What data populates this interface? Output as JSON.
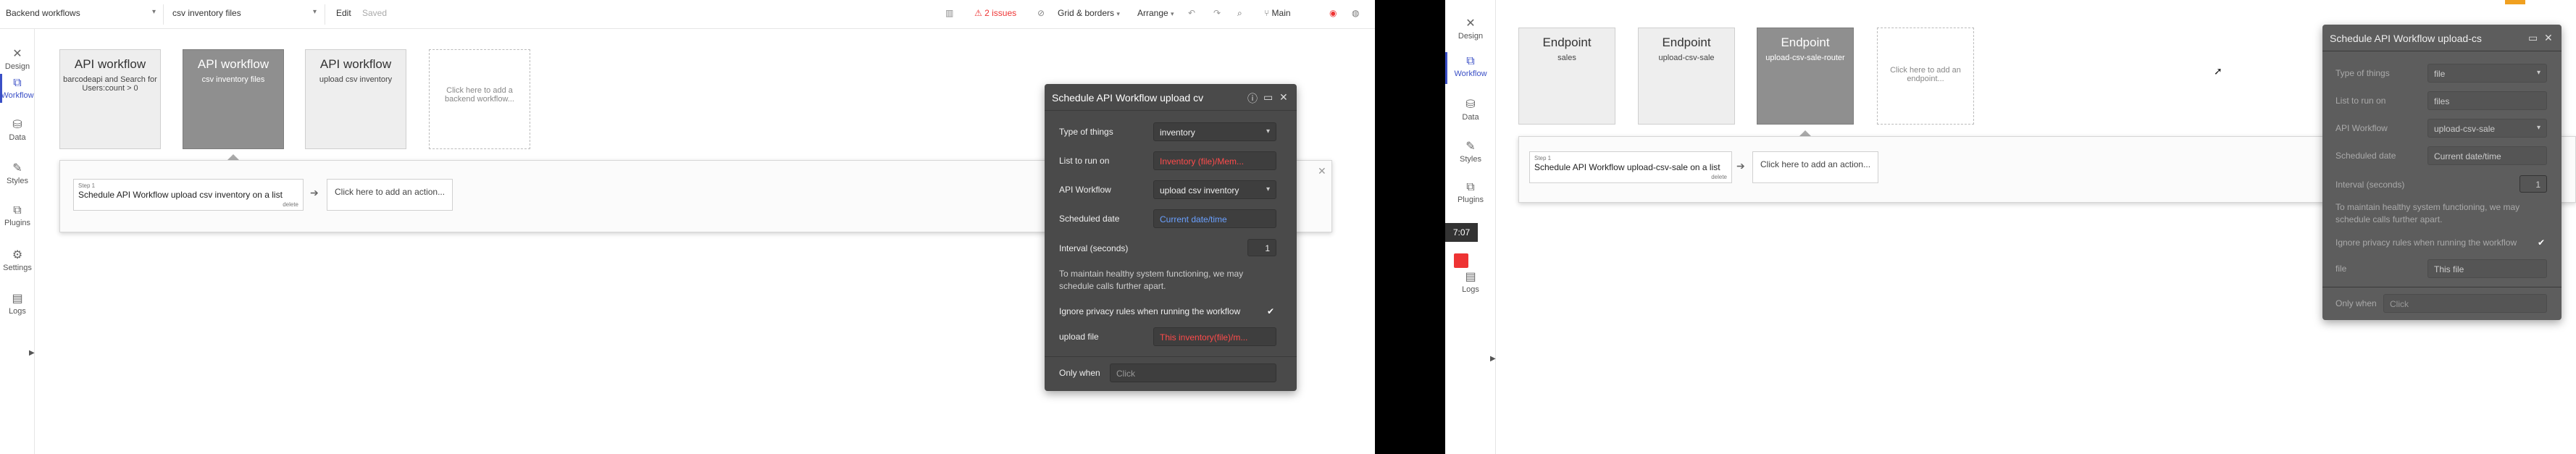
{
  "left": {
    "topbar": {
      "page_selector": "Backend workflows",
      "page_selector_caret": "▾",
      "search_value": "csv inventory files",
      "search_caret": "▾",
      "edit_label": "Edit",
      "saved_label": "Saved",
      "issues_label": "2 issues",
      "grid_label": "Grid & borders",
      "arrange_label": "Arrange",
      "branch_label": "Main"
    },
    "rail": [
      {
        "icon": "design-icon",
        "glyph": "✕",
        "label": "Design"
      },
      {
        "icon": "workflow-icon",
        "glyph": "⧉",
        "label": "Workflow"
      },
      {
        "icon": "data-icon",
        "glyph": "⛁",
        "label": "Data"
      },
      {
        "icon": "styles-icon",
        "glyph": "✎",
        "label": "Styles"
      },
      {
        "icon": "plugins-icon",
        "glyph": "⧉",
        "label": "Plugins"
      },
      {
        "icon": "settings-icon",
        "glyph": "⚙",
        "label": "Settings"
      },
      {
        "icon": "logs-icon",
        "glyph": "▤",
        "label": "Logs"
      }
    ],
    "cards": [
      {
        "title": "API workflow",
        "sub": "barcodeapi and Search for Users:count > 0"
      },
      {
        "title": "API workflow",
        "sub": "csv inventory files"
      },
      {
        "title": "API workflow",
        "sub": "upload csv inventory"
      },
      {
        "title": "",
        "sub": "Click here to add a backend workflow..."
      }
    ],
    "step": {
      "label": "Step 1",
      "text": "Schedule API Workflow upload csv inventory on a list",
      "delete": "delete"
    },
    "add_action": "Click here to add an action...",
    "editor": {
      "title": "Schedule API Workflow upload cv",
      "rows": [
        {
          "label": "Type of things",
          "value": "inventory",
          "style": "select"
        },
        {
          "label": "List to run on",
          "value": "Inventory (file)/Mem...",
          "style": "dyn-red"
        },
        {
          "label": "API Workflow",
          "value": "upload csv inventory",
          "style": "select"
        },
        {
          "label": "Scheduled date",
          "value": "Current date/time",
          "style": "dyn-blue"
        }
      ],
      "interval_label": "Interval (seconds)",
      "interval_value": "1",
      "note": "To maintain healthy system functioning, we may schedule calls further apart.",
      "ignore_label": "Ignore privacy rules when running the workflow",
      "ignore_check": "✔",
      "upload_label": "upload file",
      "upload_value": "This inventory(file)/m...",
      "only_when_label": "Only when",
      "only_when_value": "Click"
    }
  },
  "right": {
    "rail": [
      {
        "icon": "design-icon",
        "glyph": "✕",
        "label": "Design"
      },
      {
        "icon": "workflow-icon",
        "glyph": "⧉",
        "label": "Workflow"
      },
      {
        "icon": "data-icon",
        "glyph": "⛁",
        "label": "Data"
      },
      {
        "icon": "styles-icon",
        "glyph": "✎",
        "label": "Styles"
      },
      {
        "icon": "plugins-icon",
        "glyph": "⧉",
        "label": "Plugins"
      },
      {
        "icon": "settings-icon",
        "glyph": "⚙",
        "label": "Settings"
      },
      {
        "icon": "logs-icon",
        "glyph": "▤",
        "label": "Logs"
      }
    ],
    "timer": "7:07",
    "cards": [
      {
        "title": "Endpoint",
        "sub": "sales"
      },
      {
        "title": "Endpoint",
        "sub": "upload-csv-sale"
      },
      {
        "title": "Endpoint",
        "sub": "upload-csv-sale-router"
      },
      {
        "title": "",
        "sub": "Click here to add an endpoint..."
      }
    ],
    "step": {
      "label": "Step 1",
      "text": "Schedule API Workflow upload-csv-sale on a list",
      "delete": "delete"
    },
    "add_action": "Click here to add an action...",
    "editor": {
      "title": "Schedule API Workflow upload-cs",
      "rows": [
        {
          "label": "Type of things",
          "value": "file",
          "style": "select"
        },
        {
          "label": "List to run on",
          "value": "files",
          "style": "dyn-blue"
        },
        {
          "label": "API Workflow",
          "value": "upload-csv-sale",
          "style": "select"
        },
        {
          "label": "Scheduled date",
          "value": "Current date/time",
          "style": "dyn-blue"
        }
      ],
      "interval_label": "Interval (seconds)",
      "interval_value": "1",
      "note": "To maintain healthy system functioning, we may schedule calls further apart.",
      "ignore_label": "Ignore privacy rules when running the workflow",
      "ignore_check": "✔",
      "upload_label": "file",
      "upload_value": "This file",
      "only_when_label": "Only when",
      "only_when_value": "Click"
    }
  },
  "colors": {
    "accent": "#3a4fc6",
    "issues_red": "#e33",
    "dyn_blue": "#6aa0ff",
    "dyn_red": "#ff4b4b"
  }
}
